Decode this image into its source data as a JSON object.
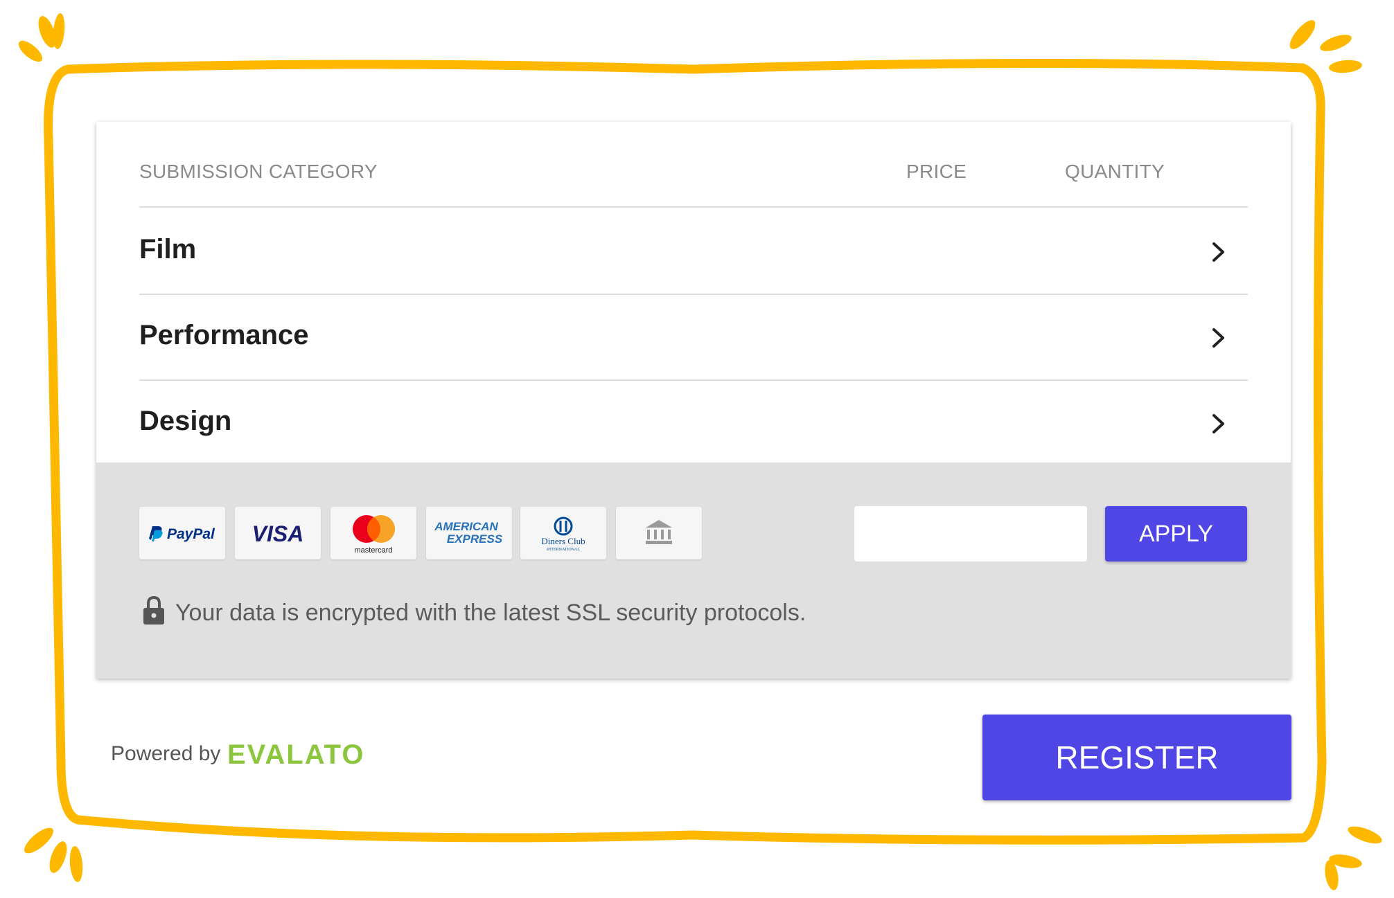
{
  "table": {
    "headers": {
      "category": "SUBMISSION CATEGORY",
      "price": "PRICE",
      "quantity": "QUANTITY"
    },
    "categories": [
      {
        "label": "Film"
      },
      {
        "label": "Performance"
      },
      {
        "label": "Design"
      }
    ]
  },
  "payment_methods": {
    "paypal": "PayPal",
    "visa": "VISA",
    "mastercard": "mastercard",
    "amex_line1": "AMERICAN",
    "amex_line2": "EXPRESS",
    "diners_line1": "Diners Club",
    "diners_line2": "INTERNATIONAL",
    "bank_icon": "bank-icon"
  },
  "coupon": {
    "value": "",
    "apply_label": "APPLY"
  },
  "security_note": "Your data is encrypted with the latest SSL security protocols.",
  "footer": {
    "powered_by": "Powered by",
    "brand": "EVALATO",
    "register_label": "REGISTER"
  },
  "colors": {
    "accent": "#4f46e5",
    "frame": "#ffb800",
    "arrow": "#ff6a13",
    "brand": "#8cc63f",
    "panel": "#e0e0e0"
  }
}
